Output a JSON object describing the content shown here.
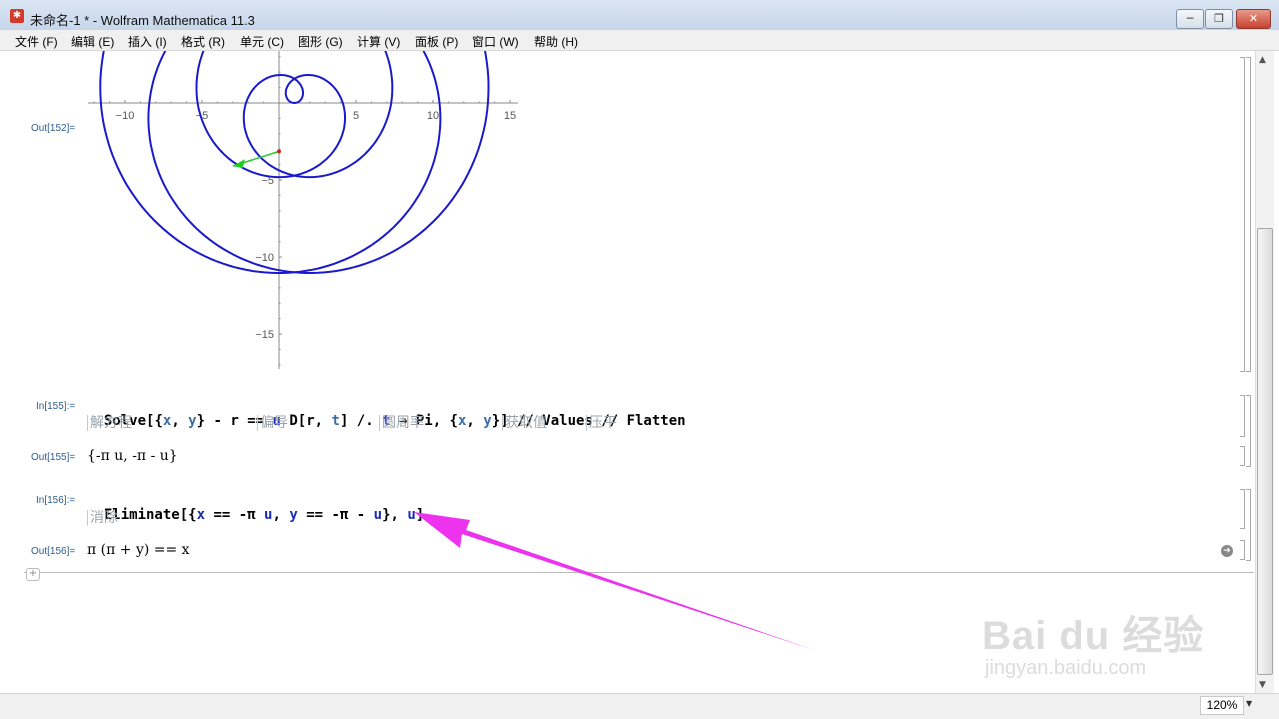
{
  "window": {
    "title": "未命名-1 * - Wolfram Mathematica 11.3",
    "minimize_label": "─",
    "maximize_label": "❐",
    "close_label": "✕"
  },
  "menu": [
    "文件 (F)",
    "编辑 (E)",
    "插入 (I)",
    "格式 (R)",
    "单元 (C)",
    "图形 (G)",
    "计算 (V)",
    "面板 (P)",
    "窗口 (W)",
    "帮助 (H)"
  ],
  "cells": {
    "out152": {
      "label": "Out[152]="
    },
    "in155": {
      "label": "In[155]:=",
      "code_parts": [
        "Solve",
        "[{",
        "x",
        ", ",
        "y",
        "} - ",
        "r",
        " == ",
        "u",
        " D[",
        "r",
        ", ",
        "t",
        "] /. ",
        "t",
        " → Pi, {",
        "x",
        ", ",
        "y",
        "}] // Values // Flatten"
      ],
      "hints": [
        "解方程",
        "偏导",
        "圆周率",
        "获取值",
        "压平"
      ]
    },
    "out155": {
      "label": "Out[155]=",
      "text": "{-π u, -π - u}"
    },
    "in156": {
      "label": "In[156]:=",
      "code_parts": [
        "Eliminate",
        "[{",
        "x",
        " == -π ",
        "u",
        ", ",
        "y",
        " == -π - ",
        "u",
        "}, ",
        "u",
        "]"
      ],
      "hints": [
        "消除"
      ]
    },
    "out156": {
      "label": "Out[156]=",
      "text": "π (π + y) == x"
    }
  },
  "chart_data": {
    "type": "line",
    "series": [
      {
        "kind": "spiral",
        "color": "#1a1acd"
      }
    ],
    "x_ticks": [
      -10,
      -5,
      5,
      10,
      15
    ],
    "y_ticks": [
      -5,
      -10,
      -15
    ],
    "x_tick_labels": [
      "−10",
      "−5",
      "5",
      "10",
      "15"
    ],
    "y_tick_labels": [
      "−5",
      "−10",
      "−15"
    ],
    "annotation_arrow": {
      "from": [
        0,
        -3.14
      ],
      "to": [
        -3,
        -4.1
      ],
      "color": "#22cc22"
    },
    "grid": false
  },
  "status": {
    "zoom": "120%"
  },
  "watermark": {
    "main": "Bai du 经验",
    "sub": "jingyan.baidu.com"
  },
  "colors": {
    "accent_arrow": "#ee33ee",
    "plot_curve": "#1a1acd",
    "label": "#2e5e8f"
  }
}
